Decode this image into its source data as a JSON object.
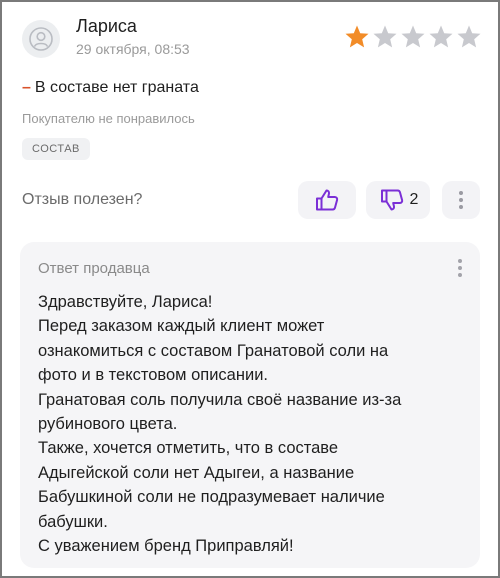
{
  "review": {
    "author": "Лариса",
    "date": "29 октября, 08:53",
    "rating": 1,
    "rating_max": 5,
    "text": "В составе нет граната",
    "verdict": "Покупателю не понравилось",
    "tag": "СОСТАВ"
  },
  "helpful": {
    "label": "Отзыв полезен?",
    "dislike_count": "2"
  },
  "seller_answer": {
    "title": "Ответ продавца",
    "lines": [
      "Здравствуйте, Лариса!",
      "Перед заказом каждый клиент может",
      "ознакомиться с составом Гранатовой соли на",
      "фото и в текстовом описании.",
      "Гранатовая соль получила своё название из-за",
      "рубинового цвета.",
      "Также, хочется отметить, что в составе",
      "Адыгейской соли нет Адыгеи, а название",
      "Бабушкиной соли не подразумевает наличие",
      "бабушки.",
      "С уважением бренд Приправляй!"
    ]
  },
  "colors": {
    "star_filled": "#f28c28",
    "star_empty": "#c8c9ce",
    "accent": "#7b2fd6",
    "dash": "#d9532b"
  }
}
